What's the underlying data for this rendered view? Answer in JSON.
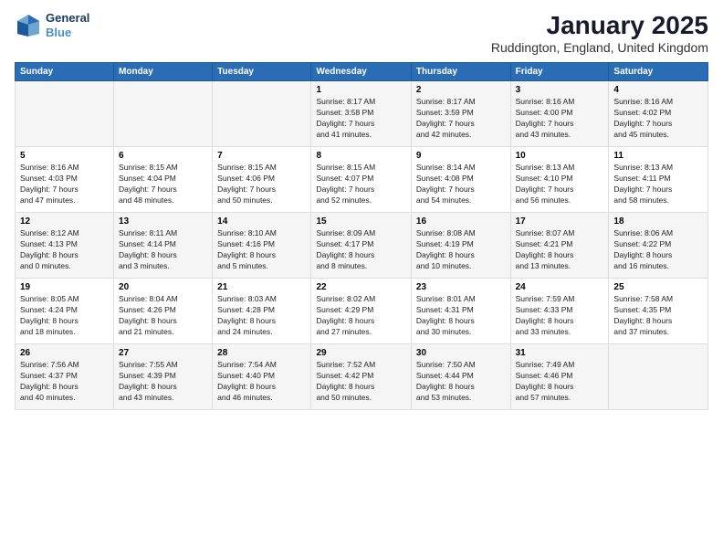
{
  "header": {
    "logo": {
      "line1": "General",
      "line2": "Blue"
    },
    "title": "January 2025",
    "subtitle": "Ruddington, England, United Kingdom"
  },
  "days_of_week": [
    "Sunday",
    "Monday",
    "Tuesday",
    "Wednesday",
    "Thursday",
    "Friday",
    "Saturday"
  ],
  "weeks": [
    [
      {
        "day": "",
        "content": ""
      },
      {
        "day": "",
        "content": ""
      },
      {
        "day": "",
        "content": ""
      },
      {
        "day": "1",
        "content": "Sunrise: 8:17 AM\nSunset: 3:58 PM\nDaylight: 7 hours\nand 41 minutes."
      },
      {
        "day": "2",
        "content": "Sunrise: 8:17 AM\nSunset: 3:59 PM\nDaylight: 7 hours\nand 42 minutes."
      },
      {
        "day": "3",
        "content": "Sunrise: 8:16 AM\nSunset: 4:00 PM\nDaylight: 7 hours\nand 43 minutes."
      },
      {
        "day": "4",
        "content": "Sunrise: 8:16 AM\nSunset: 4:02 PM\nDaylight: 7 hours\nand 45 minutes."
      }
    ],
    [
      {
        "day": "5",
        "content": "Sunrise: 8:16 AM\nSunset: 4:03 PM\nDaylight: 7 hours\nand 47 minutes."
      },
      {
        "day": "6",
        "content": "Sunrise: 8:15 AM\nSunset: 4:04 PM\nDaylight: 7 hours\nand 48 minutes."
      },
      {
        "day": "7",
        "content": "Sunrise: 8:15 AM\nSunset: 4:06 PM\nDaylight: 7 hours\nand 50 minutes."
      },
      {
        "day": "8",
        "content": "Sunrise: 8:15 AM\nSunset: 4:07 PM\nDaylight: 7 hours\nand 52 minutes."
      },
      {
        "day": "9",
        "content": "Sunrise: 8:14 AM\nSunset: 4:08 PM\nDaylight: 7 hours\nand 54 minutes."
      },
      {
        "day": "10",
        "content": "Sunrise: 8:13 AM\nSunset: 4:10 PM\nDaylight: 7 hours\nand 56 minutes."
      },
      {
        "day": "11",
        "content": "Sunrise: 8:13 AM\nSunset: 4:11 PM\nDaylight: 7 hours\nand 58 minutes."
      }
    ],
    [
      {
        "day": "12",
        "content": "Sunrise: 8:12 AM\nSunset: 4:13 PM\nDaylight: 8 hours\nand 0 minutes."
      },
      {
        "day": "13",
        "content": "Sunrise: 8:11 AM\nSunset: 4:14 PM\nDaylight: 8 hours\nand 3 minutes."
      },
      {
        "day": "14",
        "content": "Sunrise: 8:10 AM\nSunset: 4:16 PM\nDaylight: 8 hours\nand 5 minutes."
      },
      {
        "day": "15",
        "content": "Sunrise: 8:09 AM\nSunset: 4:17 PM\nDaylight: 8 hours\nand 8 minutes."
      },
      {
        "day": "16",
        "content": "Sunrise: 8:08 AM\nSunset: 4:19 PM\nDaylight: 8 hours\nand 10 minutes."
      },
      {
        "day": "17",
        "content": "Sunrise: 8:07 AM\nSunset: 4:21 PM\nDaylight: 8 hours\nand 13 minutes."
      },
      {
        "day": "18",
        "content": "Sunrise: 8:06 AM\nSunset: 4:22 PM\nDaylight: 8 hours\nand 16 minutes."
      }
    ],
    [
      {
        "day": "19",
        "content": "Sunrise: 8:05 AM\nSunset: 4:24 PM\nDaylight: 8 hours\nand 18 minutes."
      },
      {
        "day": "20",
        "content": "Sunrise: 8:04 AM\nSunset: 4:26 PM\nDaylight: 8 hours\nand 21 minutes."
      },
      {
        "day": "21",
        "content": "Sunrise: 8:03 AM\nSunset: 4:28 PM\nDaylight: 8 hours\nand 24 minutes."
      },
      {
        "day": "22",
        "content": "Sunrise: 8:02 AM\nSunset: 4:29 PM\nDaylight: 8 hours\nand 27 minutes."
      },
      {
        "day": "23",
        "content": "Sunrise: 8:01 AM\nSunset: 4:31 PM\nDaylight: 8 hours\nand 30 minutes."
      },
      {
        "day": "24",
        "content": "Sunrise: 7:59 AM\nSunset: 4:33 PM\nDaylight: 8 hours\nand 33 minutes."
      },
      {
        "day": "25",
        "content": "Sunrise: 7:58 AM\nSunset: 4:35 PM\nDaylight: 8 hours\nand 37 minutes."
      }
    ],
    [
      {
        "day": "26",
        "content": "Sunrise: 7:56 AM\nSunset: 4:37 PM\nDaylight: 8 hours\nand 40 minutes."
      },
      {
        "day": "27",
        "content": "Sunrise: 7:55 AM\nSunset: 4:39 PM\nDaylight: 8 hours\nand 43 minutes."
      },
      {
        "day": "28",
        "content": "Sunrise: 7:54 AM\nSunset: 4:40 PM\nDaylight: 8 hours\nand 46 minutes."
      },
      {
        "day": "29",
        "content": "Sunrise: 7:52 AM\nSunset: 4:42 PM\nDaylight: 8 hours\nand 50 minutes."
      },
      {
        "day": "30",
        "content": "Sunrise: 7:50 AM\nSunset: 4:44 PM\nDaylight: 8 hours\nand 53 minutes."
      },
      {
        "day": "31",
        "content": "Sunrise: 7:49 AM\nSunset: 4:46 PM\nDaylight: 8 hours\nand 57 minutes."
      },
      {
        "day": "",
        "content": ""
      }
    ]
  ]
}
